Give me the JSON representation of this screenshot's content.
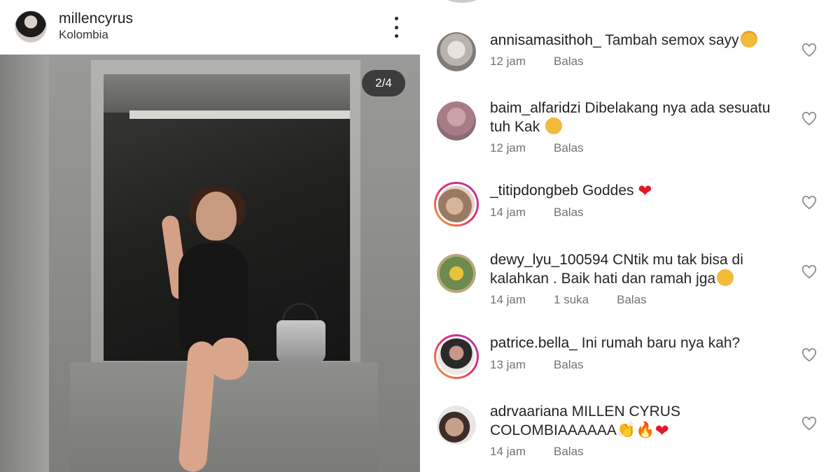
{
  "post": {
    "username": "millencyrus",
    "location": "Kolombia",
    "counter": "2/4"
  },
  "comments": [
    {
      "user": "annisamasithoh_",
      "text": "Tambah semox sayy",
      "emoji": "heart-eyes-emoji",
      "time": "12 jam",
      "likes": "",
      "reply": "Balas"
    },
    {
      "user": "baim_alfaridzi",
      "text": "Dibelakang nya ada sesuatu tuh Kak",
      "emoji": "surprised-emoji",
      "time": "12 jam",
      "likes": "",
      "reply": "Balas"
    },
    {
      "user": "_titipdongbeb",
      "text": "Goddes",
      "emoji": "red-heart-emoji",
      "time": "14 jam",
      "likes": "",
      "reply": "Balas"
    },
    {
      "user": "dewy_lyu_100594",
      "text": "CNtik mu tak bisa di kalahkan . Baik hati dan ramah jga",
      "emoji": "kiss-emoji",
      "time": "14 jam",
      "likes": "1 suka",
      "reply": "Balas"
    },
    {
      "user": "patrice.bella_",
      "text": "Ini rumah baru nya kah?",
      "emoji": "",
      "time": "13 jam",
      "likes": "",
      "reply": "Balas"
    },
    {
      "user": "adrvaariana",
      "text": "MILLEN CYRUS COLOMBIAAAAAA",
      "emoji": "clap-fire-heart-emoji",
      "time": "14 jam",
      "likes": "",
      "reply": "Balas"
    }
  ],
  "colors": {
    "text": "#262626",
    "meta": "#737373",
    "heart": "#e0192d",
    "story_ring": [
      "#f9a532",
      "#e1306c",
      "#b533b5"
    ]
  }
}
